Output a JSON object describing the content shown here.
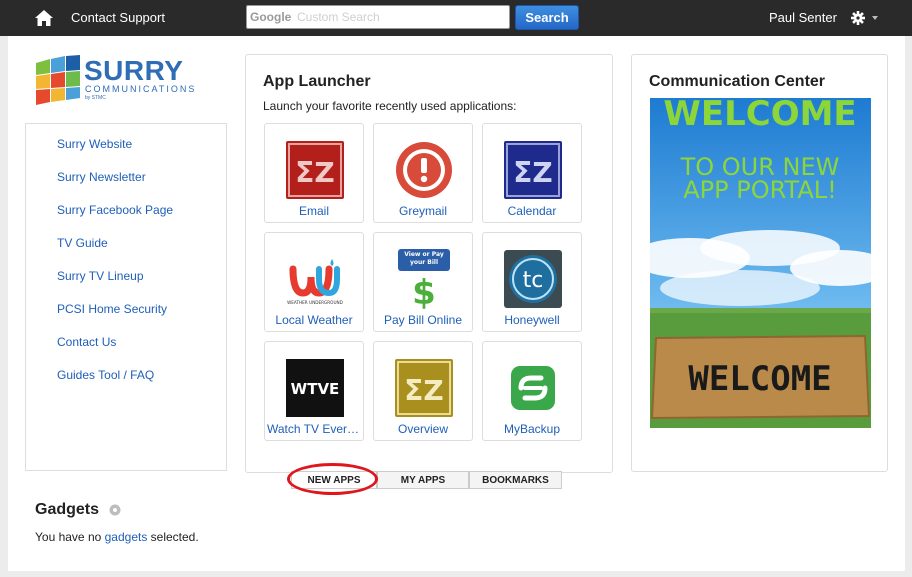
{
  "topbar": {
    "contact_support": "Contact Support",
    "search_brand": "Google",
    "search_placeholder": "Custom Search",
    "search_button": "Search",
    "user_name": "Paul Senter"
  },
  "logo": {
    "name": "SURRY",
    "line2": "COMMUNICATIONS",
    "line3": "by STMC"
  },
  "sidebar": {
    "items": [
      {
        "label": "Surry Website"
      },
      {
        "label": "Surry Newsletter"
      },
      {
        "label": "Surry Facebook Page"
      },
      {
        "label": "TV Guide"
      },
      {
        "label": "Surry TV Lineup"
      },
      {
        "label": "PCSI Home Security"
      },
      {
        "label": "Contact Us"
      },
      {
        "label": "Guides Tool / FAQ"
      }
    ]
  },
  "launcher": {
    "title": "App Launcher",
    "subtitle": "Launch your favorite recently used applications:",
    "apps": [
      {
        "label": "Email",
        "icon": "ez-email-icon"
      },
      {
        "label": "Greymail",
        "icon": "greymail-icon"
      },
      {
        "label": "Calendar",
        "icon": "ez-calendar-icon"
      },
      {
        "label": "Local Weather",
        "icon": "weather-underground-icon",
        "icon_text": "WEATHER UNDERGROUND"
      },
      {
        "label": "Pay Bill Online",
        "icon": "pay-bill-icon",
        "icon_text": "View or Pay your Bill"
      },
      {
        "label": "Honeywell",
        "icon": "honeywell-tc-icon"
      },
      {
        "label": "Watch TV Everywhere",
        "icon": "wtve-icon"
      },
      {
        "label": "Overview",
        "icon": "ez-overview-icon"
      },
      {
        "label": "MyBackup",
        "icon": "mybackup-icon"
      }
    ]
  },
  "comm": {
    "title": "Communication Center",
    "welcome_big": "WELCOME",
    "welcome_line2": "TO OUR NEW",
    "welcome_line3": "APP PORTAL!",
    "mat_text": "WELCOME"
  },
  "tabs": {
    "new_apps": "NEW APPS",
    "my_apps": "MY APPS",
    "bookmarks": "BOOKMARKS"
  },
  "gadgets": {
    "title": "Gadgets",
    "text_before": "You have no ",
    "link": "gadgets",
    "text_after": " selected."
  },
  "colors": {
    "link": "#1f5fb8",
    "topbar": "#2a2a2a",
    "search_button": "#2467c9",
    "highlight_ring": "#e0161d"
  }
}
